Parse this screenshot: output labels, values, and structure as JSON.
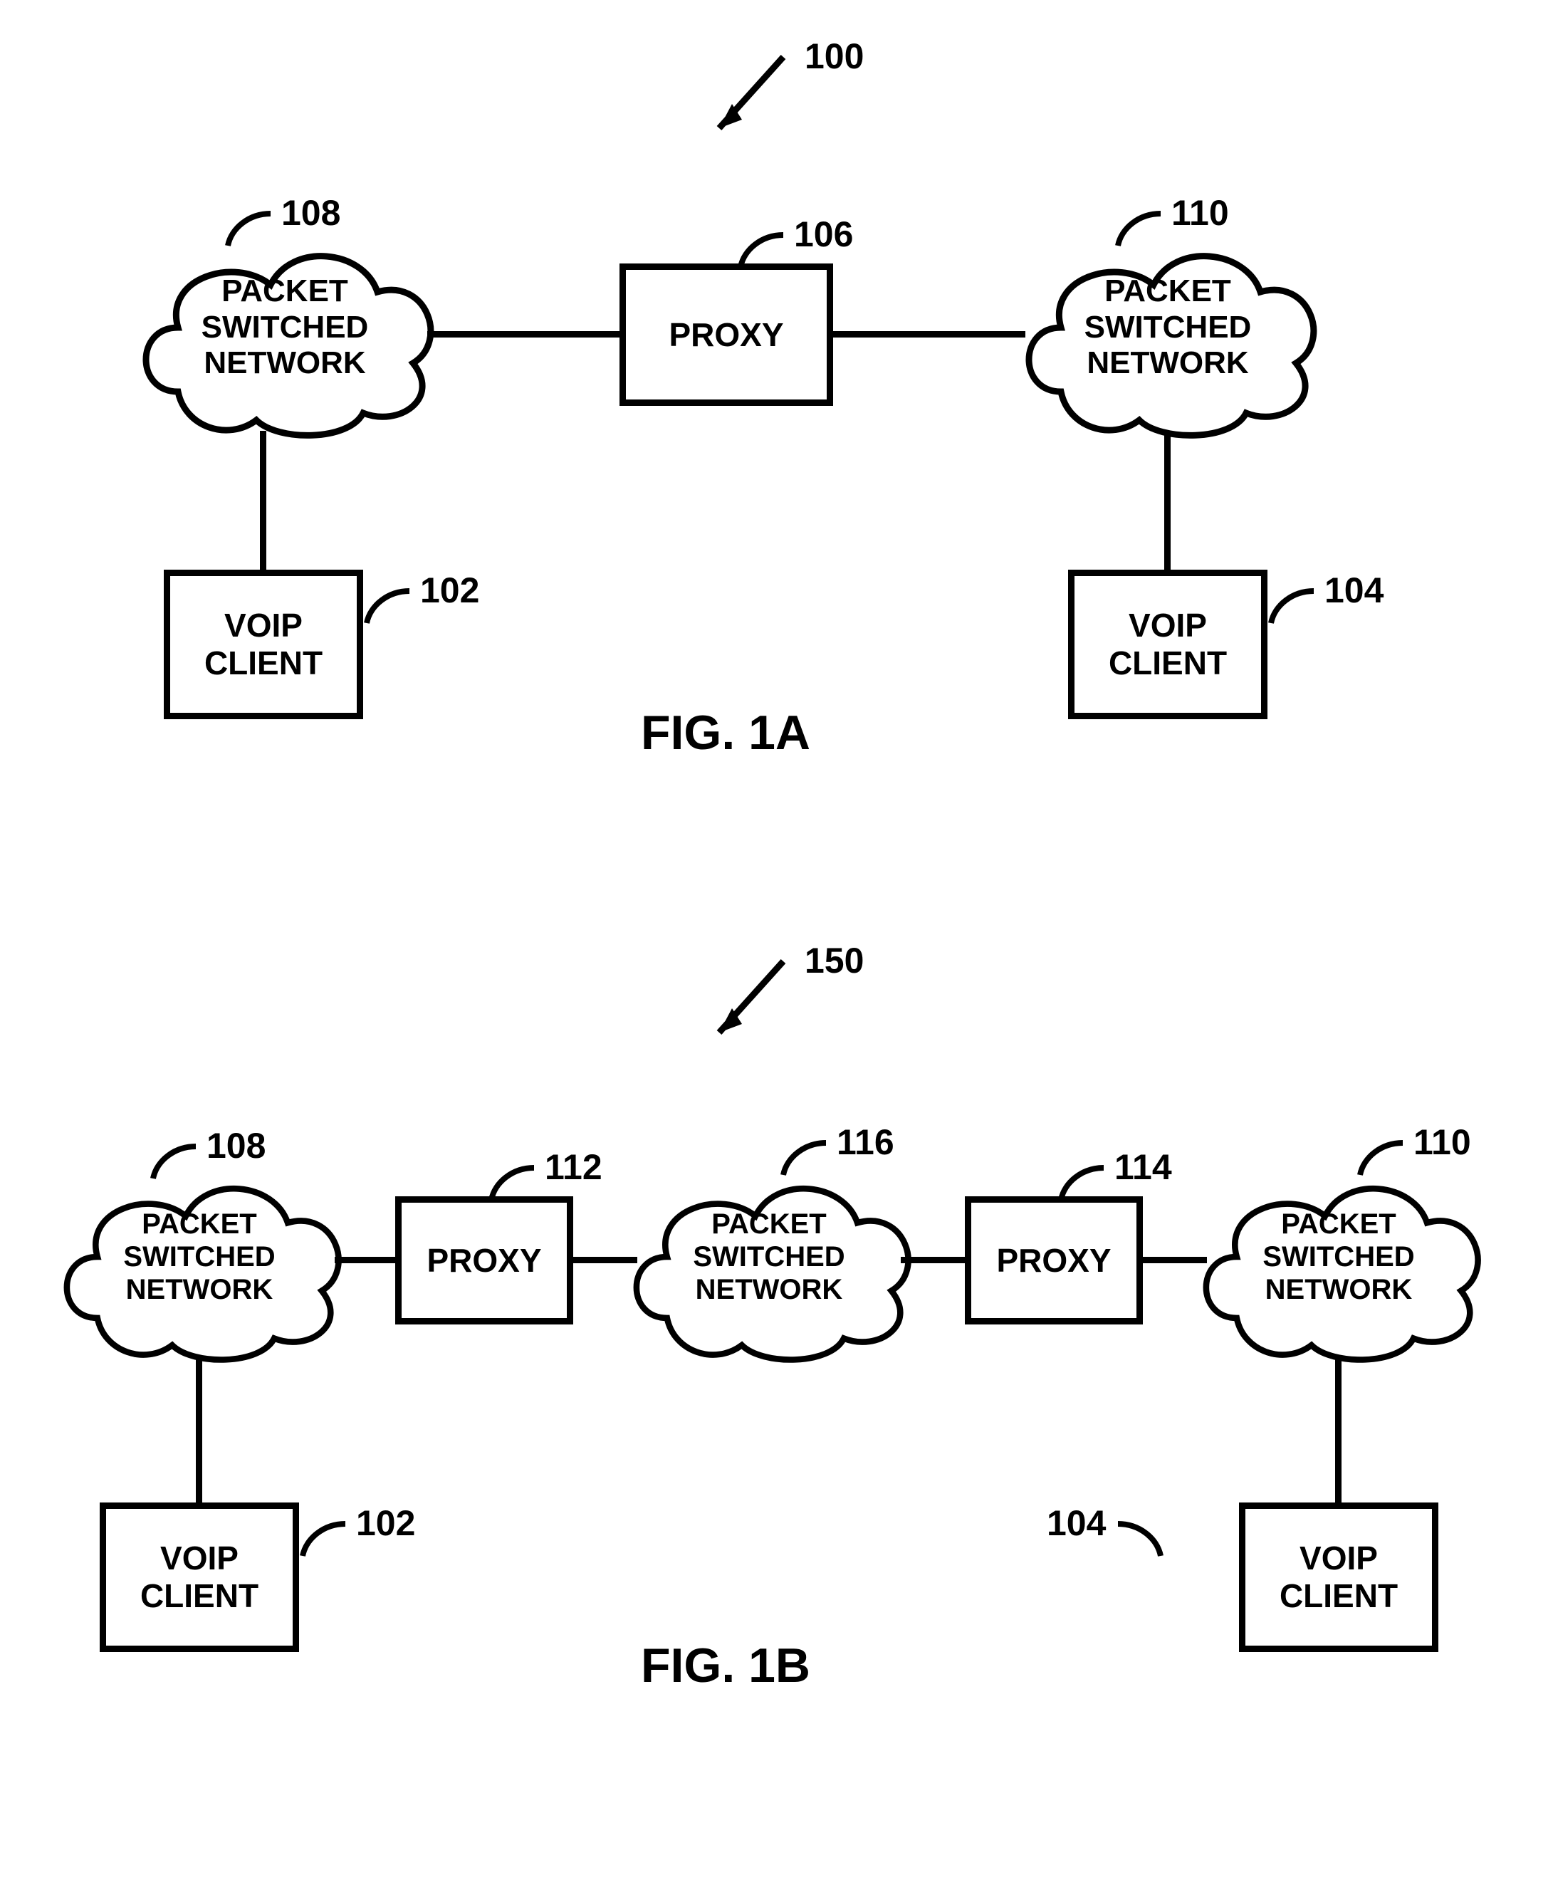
{
  "figA": {
    "ref_figure": "100",
    "caption": "FIG. 1A",
    "cloud_left": {
      "ref": "108",
      "text": "PACKET\nSWITCHED\nNETWORK"
    },
    "cloud_right": {
      "ref": "110",
      "text": "PACKET\nSWITCHED\nNETWORK"
    },
    "proxy": {
      "ref": "106",
      "text": "PROXY"
    },
    "client_left": {
      "ref": "102",
      "text": "VOIP\nCLIENT"
    },
    "client_right": {
      "ref": "104",
      "text": "VOIP\nCLIENT"
    }
  },
  "figB": {
    "ref_figure": "150",
    "caption": "FIG. 1B",
    "cloud_left": {
      "ref": "108",
      "text": "PACKET\nSWITCHED\nNETWORK"
    },
    "cloud_mid": {
      "ref": "116",
      "text": "PACKET\nSWITCHED\nNETWORK"
    },
    "cloud_right": {
      "ref": "110",
      "text": "PACKET\nSWITCHED\nNETWORK"
    },
    "proxy_left": {
      "ref": "112",
      "text": "PROXY"
    },
    "proxy_right": {
      "ref": "114",
      "text": "PROXY"
    },
    "client_left": {
      "ref": "102",
      "text": "VOIP\nCLIENT"
    },
    "client_right": {
      "ref": "104",
      "text": "VOIP\nCLIENT"
    }
  }
}
